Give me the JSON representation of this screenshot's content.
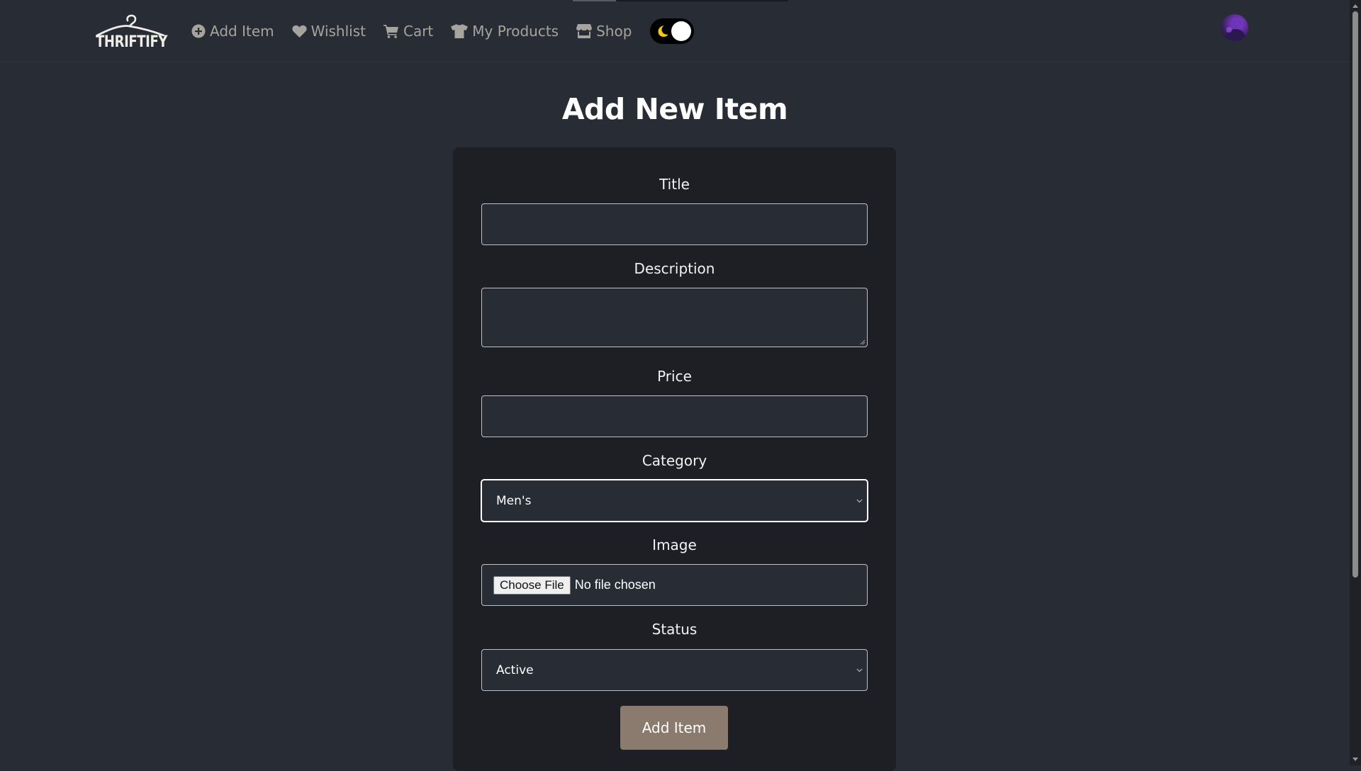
{
  "app": {
    "logo_text": "THRIFTIFY"
  },
  "nav": {
    "add_item": "Add Item",
    "wishlist": "Wishlist",
    "cart": "Cart",
    "my_products": "My Products",
    "shop": "Shop",
    "theme_toggle": "dark"
  },
  "page": {
    "title": "Add New Item"
  },
  "form": {
    "title_label": "Title",
    "title_value": "",
    "description_label": "Description",
    "description_value": "",
    "price_label": "Price",
    "price_value": "",
    "category_label": "Category",
    "category_selected": "Men's",
    "image_label": "Image",
    "file_button": "Choose File",
    "file_status": "No file chosen",
    "status_label": "Status",
    "status_selected": "Active",
    "submit_label": "Add Item"
  },
  "colors": {
    "background": "#282c35",
    "card": "#1d1f24",
    "nav_text": "#a7a39d",
    "submit_button": "#8a7b6e",
    "toggle_moon": "#f5c518"
  },
  "icons": {
    "add_item": "plus-circle-icon",
    "wishlist": "heart-icon",
    "cart": "cart-icon",
    "my_products": "shirt-icon",
    "shop": "store-icon",
    "toggle": "moon-icon"
  }
}
